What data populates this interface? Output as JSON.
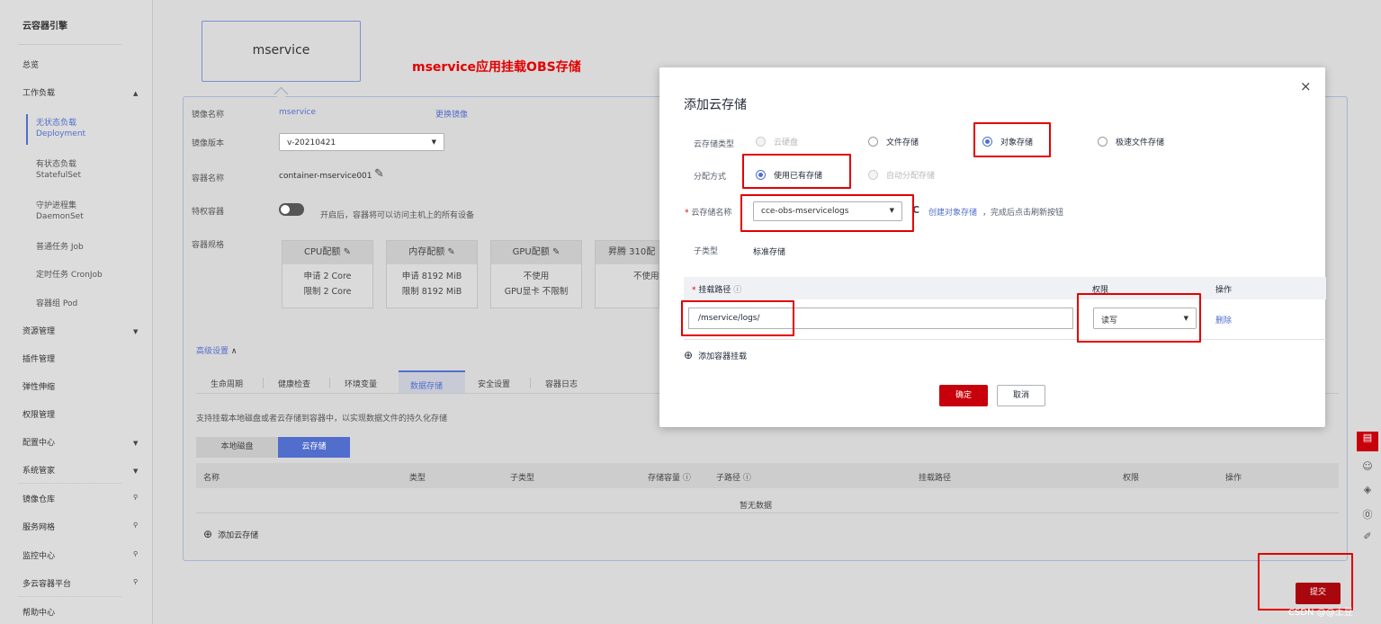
{
  "sidebar": {
    "title": "云容器引擎",
    "items": {
      "overview": "总览",
      "workload": "工作负载",
      "deployment_cn": "无状态负载",
      "deployment_en": "Deployment",
      "statefulset_cn": "有状态负载",
      "statefulset_en": "StatefulSet",
      "daemonset_cn": "守护进程集",
      "daemonset_en": "DaemonSet",
      "job": "普通任务 Job",
      "cronjob": "定时任务 CronJob",
      "pod": "容器组 Pod",
      "resource": "资源管理",
      "addon": "插件管理",
      "elastic": "弹性伸缩",
      "permission": "权限管理",
      "config": "配置中心",
      "system": "系统管家",
      "image": "镜像仓库",
      "mesh": "服务网格",
      "monitor": "监控中心",
      "multicloud": "多云容器平台",
      "help": "帮助中心"
    }
  },
  "service": {
    "name": "mservice",
    "annotation": "mservice应用挂载OBS存储"
  },
  "form": {
    "image_name_label": "镜像名称",
    "image_name": "mservice",
    "change_image": "更换镜像",
    "image_version_label": "镜像版本",
    "image_version": "v-20210421",
    "container_name_label": "容器名称",
    "container_name": "container-mservice001",
    "privileged_label": "特权容器",
    "privileged_hint": "开启后，容器将可以访问主机上的所有设备",
    "spec_label": "容器规格"
  },
  "spec_cards": [
    {
      "title": "CPU配额",
      "l1": "申请 2 Core",
      "l2": "限制 2 Core"
    },
    {
      "title": "内存配额",
      "l1": "申请 8192 MiB",
      "l2": "限制 8192 MiB"
    },
    {
      "title": "GPU配额",
      "l1": "不使用",
      "l2": "GPU显卡 不限制"
    },
    {
      "title": "昇腾 310配",
      "l1": "不使用",
      "l2": ""
    }
  ],
  "advanced": {
    "toggle": "高级设置",
    "tabs": [
      "生命周期",
      "健康检查",
      "环境变量",
      "数据存储",
      "安全设置",
      "容器日志"
    ],
    "desc": "支持挂载本地磁盘或者云存储到容器中，以实现数据文件的持久化存储",
    "subtabs": [
      "本地磁盘",
      "云存储"
    ],
    "columns": [
      "名称",
      "类型",
      "子类型",
      "存储容量",
      "子路径",
      "挂载路径",
      "权限",
      "操作"
    ],
    "empty": "暂无数据",
    "add": "添加云存储"
  },
  "submit": "提交",
  "watermark": "CSDN @@土豆",
  "modal": {
    "title": "添加云存储",
    "close": "×",
    "type_label": "云存储类型",
    "types": [
      "云硬盘",
      "文件存储",
      "对象存储",
      "极速文件存储"
    ],
    "alloc_label": "分配方式",
    "allocs": [
      "使用已有存储",
      "自动分配存储"
    ],
    "name_label": "云存储名称",
    "name_value": "cce-obs-mservicelogs",
    "refresh": "C",
    "create_link": "创建对象存储",
    "create_hint": "，完成后点击刷新按钮",
    "subtype_label": "子类型",
    "subtype_value": "标准存储",
    "mount_label": "挂载路径",
    "perm_label": "权限",
    "op_label": "操作",
    "mount_value": "/mservice/logs/",
    "perm_value": "读写",
    "delete": "删除",
    "add_mount": "添加容器挂载",
    "ok": "确定",
    "cancel": "取消",
    "colors": {
      "primary": "#c7000b",
      "accent": "#526ecc",
      "highlight": "#e30000"
    }
  }
}
